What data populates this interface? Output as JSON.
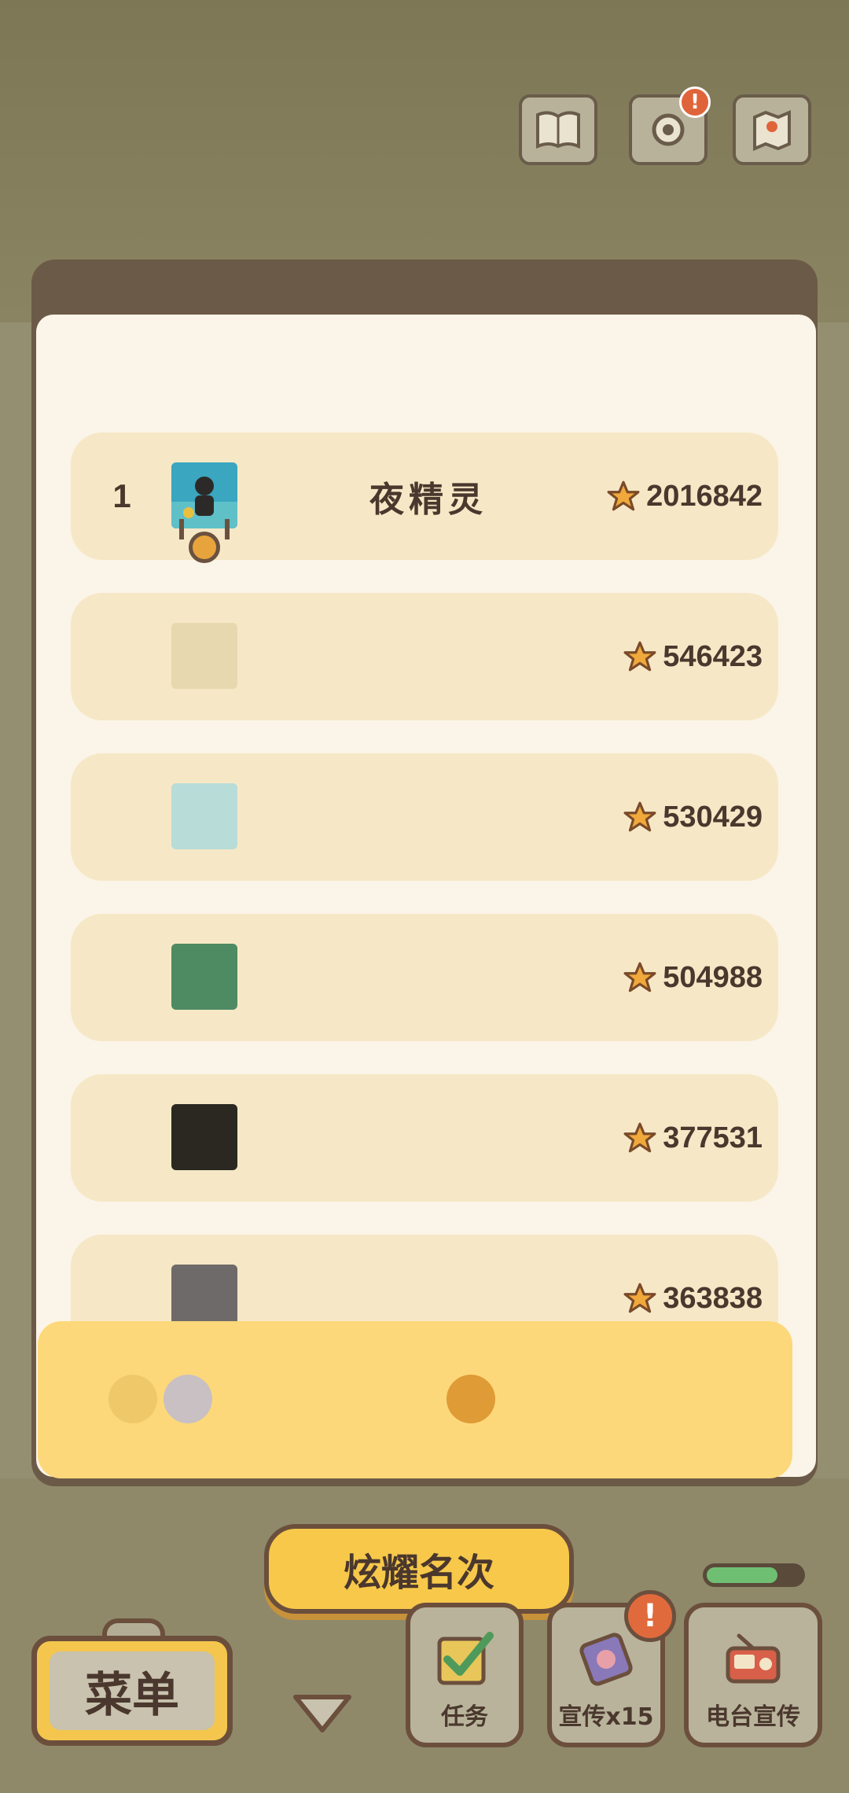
{
  "panel": {
    "title": ""
  },
  "leaderboard": {
    "rows": [
      {
        "rank": "1",
        "name": "夜精灵",
        "score": "2016842"
      },
      {
        "rank": "",
        "name": "",
        "score": "546423"
      },
      {
        "rank": "",
        "name": "",
        "score": "530429"
      },
      {
        "rank": "",
        "name": "",
        "score": "504988"
      },
      {
        "rank": "",
        "name": "",
        "score": "377531"
      },
      {
        "rank": "",
        "name": "",
        "score": "363838"
      }
    ]
  },
  "buttons": {
    "show_rank": "炫耀名次",
    "menu": "菜单",
    "tasks": "任务",
    "promote": "宣传x15",
    "radio": "电台宣传"
  },
  "top_bar": {
    "notification_badge": "!"
  },
  "bottom_alert": "!",
  "progress": {
    "level": 0.75
  },
  "colors": {
    "panel_bg": "#fbf4e8",
    "row_bg": "#f6e8c6",
    "self_row_bg": "#fdd87a",
    "button_yellow": "#f7c84a",
    "text_brown": "#4a372d",
    "star_orange": "#f0a93a"
  },
  "icons": {
    "score": "star-icon",
    "tasks": "checkbox-icon",
    "promote": "flyer-icon",
    "radio": "radio-icon",
    "menu_expand": "chevron-down-icon",
    "book": "book-icon",
    "settings": "gear-icon",
    "map": "map-icon"
  }
}
